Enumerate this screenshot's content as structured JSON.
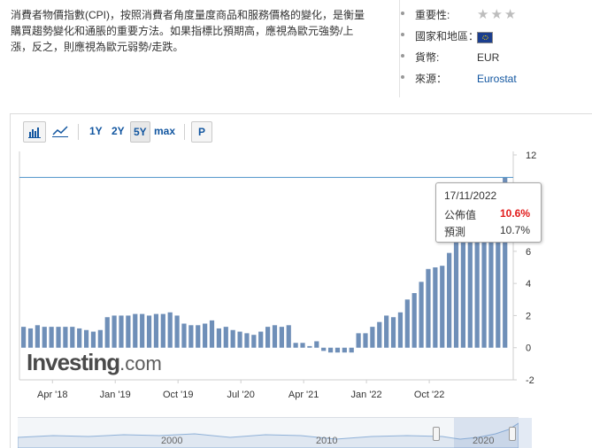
{
  "description": "消費者物價指數(CPI)，按照消費者角度量度商品和服務價格的變化，是衡量購買趨勢變化和通脹的重要方法。如果指標比預期高，應視為歐元強勢/上漲，反之，則應視為歐元弱勢/走跌。",
  "meta": {
    "importance_label": "重要性:",
    "importance_stars": "★★★",
    "country_label": "國家和地區：",
    "country_flag": "eu-flag-icon",
    "currency_label": "貨幣:",
    "currency_value": "EUR",
    "source_label": "來源：",
    "source_value": "Eurostat"
  },
  "toolbar": {
    "bar_icon": "bar-chart-icon",
    "line_icon": "line-chart-icon",
    "periods": [
      "1Y",
      "2Y",
      "5Y",
      "max"
    ],
    "active_period": "5Y",
    "p_label": "P"
  },
  "tooltip": {
    "date": "17/11/2022",
    "actual_label": "公佈值",
    "actual_value": "10.6%",
    "forecast_label": "預測",
    "forecast_value": "10.7%"
  },
  "logo": {
    "main": "Investing",
    "suffix": ".com"
  },
  "navigator": {
    "labels": [
      "2000",
      "2010",
      "2020"
    ]
  },
  "colors": {
    "bar": "#6f8fb8",
    "reference_line": "#4a90c8",
    "actual_value": "#e21b1b",
    "link": "#1256a0"
  },
  "chart_data": {
    "type": "bar",
    "y_ticks": [
      "12",
      "10",
      "8",
      "6",
      "4",
      "2",
      "0",
      "-2"
    ],
    "ylim": [
      -2,
      12
    ],
    "x_ticks": [
      "Apr '18",
      "Jan '19",
      "Oct '19",
      "Jul '20",
      "Apr '21",
      "Jan '22",
      "Oct '22"
    ],
    "reference_line": 10.6,
    "grid": false,
    "start_month": "Jan 2018",
    "values": [
      1.3,
      1.2,
      1.4,
      1.3,
      1.3,
      1.3,
      1.3,
      1.3,
      1.2,
      1.1,
      1.0,
      1.1,
      1.9,
      2.0,
      2.0,
      2.0,
      2.1,
      2.1,
      2.0,
      2.1,
      2.1,
      2.2,
      2.0,
      1.5,
      1.4,
      1.4,
      1.5,
      1.7,
      1.2,
      1.3,
      1.1,
      1.0,
      0.9,
      0.8,
      1.0,
      1.3,
      1.4,
      1.3,
      1.4,
      0.3,
      0.3,
      0.1,
      0.4,
      -0.2,
      -0.3,
      -0.3,
      -0.3,
      -0.3,
      0.9,
      0.9,
      1.3,
      1.6,
      2.0,
      1.9,
      2.2,
      3.0,
      3.4,
      4.1,
      4.9,
      5.0,
      5.1,
      5.9,
      7.4,
      7.4,
      8.1,
      8.6,
      8.9,
      9.1,
      9.9,
      10.6
    ]
  }
}
